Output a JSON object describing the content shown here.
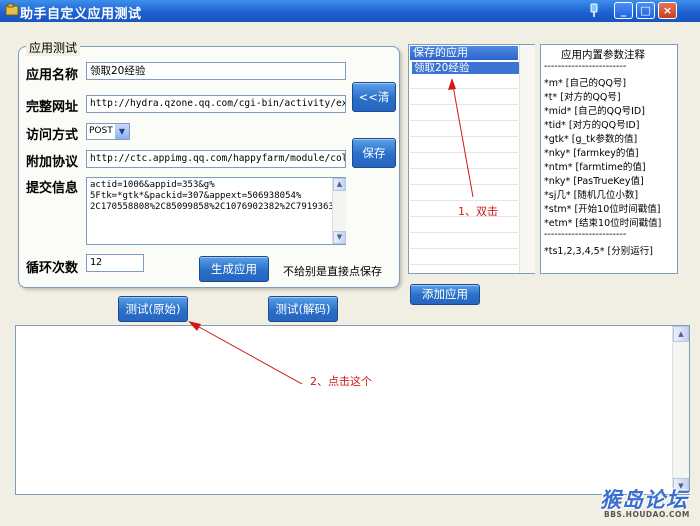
{
  "window": {
    "title": "助手自定义应用测试",
    "controls": {
      "minimize": "_",
      "maximize": "□",
      "close": "×"
    }
  },
  "form": {
    "group_title": "应用测试",
    "app_name": {
      "label": "应用名称",
      "value": "领取20经验"
    },
    "full_url": {
      "label": "完整网址",
      "value": "http://hydra.qzone.qq.com/cgi-bin/activity/exchan"
    },
    "method": {
      "label": "访问方式",
      "value": "POST"
    },
    "extra_protocol": {
      "label": "附加协议",
      "value": "http://ctc.appimg.qq.com/happyfarm/module/collect"
    },
    "submit_info": {
      "label": "提交信息",
      "lines": [
        "actid=1006&appid=353&g%",
        "5Ftk=*gtk*&packid=307&appext=506938054%",
        "2C170558808%2C85099858%2C1076902382%2C7919363"
      ]
    },
    "loop_count": {
      "label": "循环次数",
      "value": "12"
    },
    "clear_button": "<<清空",
    "save_button": "保存>>",
    "generate_button": "生成应用",
    "save_hint": "不给别是直接点保存"
  },
  "saved_apps": {
    "header": "保存的应用",
    "items": [
      "领取20经验"
    ],
    "add_button": "添加应用"
  },
  "notes": {
    "title": "应用内置参数注释",
    "lines": [
      "------------------------",
      "*m*  [自己的QQ号]",
      "*t*  [对方的QQ号]",
      "*mid* [自己的QQ号ID]",
      "*tid* [对方的QQ号ID]",
      "*gtk* [g_tk参数的值]",
      "*nky* [farmkey的值]",
      "*ntm* [farmtime的值]",
      "*nky* [PasTrueKey值]",
      "*sj几* [随机几位小数]",
      "*stm* [开始10位时间戳值]",
      "*etm* [结束10位时间戳值]",
      "------------------------",
      "*ts1,2,3,4,5* [分别运行]"
    ]
  },
  "test_raw_button": "测试(原始)",
  "test_decode_button": "测试(解码)",
  "annotations": {
    "step1": "1、双击",
    "step2": "2、点击这个"
  },
  "watermark": {
    "text": "猴岛论坛",
    "sub": "BBS.HOUDAO.COM"
  },
  "colors": {
    "title_bar": "#1c5fd0",
    "button": "#2a6fc8",
    "selection": "#3b73d4",
    "annotation": "#d21818"
  }
}
